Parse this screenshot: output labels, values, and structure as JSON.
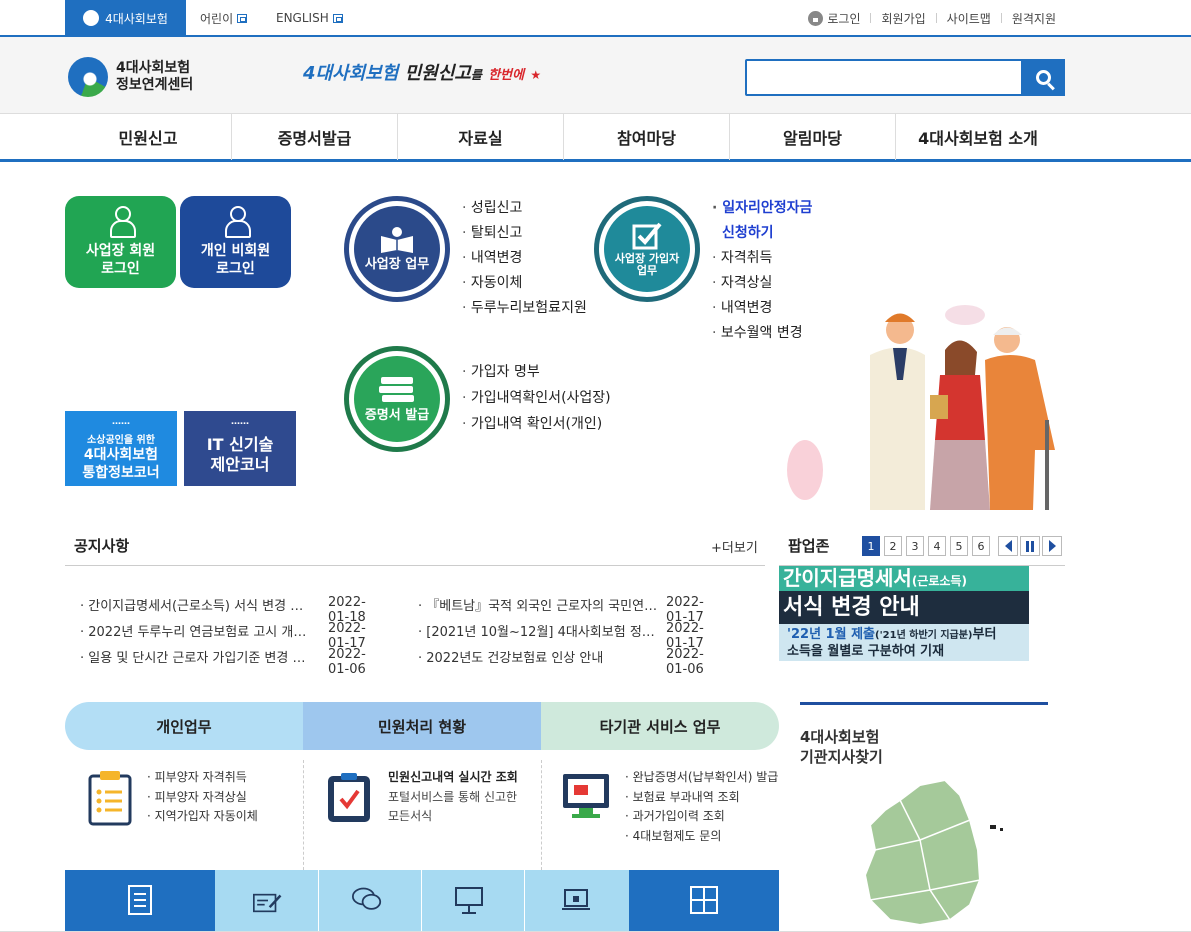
{
  "utility": {
    "main_tab": "4대사회보험",
    "kids": "어린이",
    "english": "ENGLISH",
    "login": "로그인",
    "join": "회원가입",
    "sitemap": "사이트맵",
    "remote": "원격지원"
  },
  "header": {
    "logo_line1": "4대사회보험",
    "logo_line2": "정보연계센터",
    "slogan_a": "4대사회보험",
    "slogan_b": "민원신고",
    "slogan_c": "를",
    "slogan_d": "한번에",
    "search_placeholder": ""
  },
  "gnb": [
    "민원신고",
    "증명서발급",
    "자료실",
    "참여마당",
    "알림마당",
    "4대사회보험 소개"
  ],
  "login_tiles": {
    "business_line1": "사업장 회원",
    "business_line2": "로그인",
    "personal_line1": "개인 비회원",
    "personal_line2": "로그인"
  },
  "promos": {
    "smallbiz_small": "소상공인을 위한",
    "smallbiz_line1": "4대사회보험",
    "smallbiz_line2": "통합정보코너",
    "it_line1": "IT 신기술",
    "it_line2": "제안코너"
  },
  "work": {
    "business": {
      "label": "사업장 업무",
      "items": [
        "성립신고",
        "탈퇴신고",
        "내역변경",
        "자동이체",
        "두루누리보험료지원"
      ]
    },
    "subscriber": {
      "label_line1": "사업장 가입자",
      "label_line2": "업무",
      "highlight_line1": "일자리안정자금",
      "highlight_line2": "신청하기",
      "items": [
        "자격취득",
        "자격상실",
        "내역변경",
        "보수월액 변경"
      ]
    },
    "certificate": {
      "label": "증명서 발급",
      "items": [
        "가입자 명부",
        "가입내역확인서(사업장)",
        "가입내역 확인서(개인)"
      ]
    }
  },
  "notice": {
    "title": "공지사항",
    "more": "+더보기",
    "items": [
      {
        "title": "간이지급명세서(근로소득) 서식 변경 …",
        "date": "2022-01-18"
      },
      {
        "title": "2022년 두루누리 연금보험료 고시 개…",
        "date": "2022-01-17"
      },
      {
        "title": "일용 및 단시간 근로자 가입기준 변경 …",
        "date": "2022-01-06"
      },
      {
        "title": "『베트남』국적 외국인 근로자의 국민연…",
        "date": "2022-01-17"
      },
      {
        "title": "[2021년 10월~12월] 4대사회보험 정…",
        "date": "2022-01-17"
      },
      {
        "title": "2022년도 건강보험료 인상 안내",
        "date": "2022-01-06"
      }
    ]
  },
  "popup": {
    "title": "팝업존",
    "pages": [
      "1",
      "2",
      "3",
      "4",
      "5",
      "6"
    ],
    "banner_line1": "간이지급명세서",
    "banner_line1_tag": "(근로소득)",
    "banner_line2": "서식 변경 안내",
    "banner_line3a": "'22년 1월 제출",
    "banner_line3b": "('21년 하반기 지급분)",
    "banner_line3c": "부터",
    "banner_line4": "소득을 월별로 구분하여 기재"
  },
  "services": {
    "tabs": [
      "개인업무",
      "민원처리 현황",
      "타기관 서비스 업무"
    ],
    "personal": [
      "피부양자 자격취득",
      "피부양자 자격상실",
      "지역가입자 자동이체"
    ],
    "status_title": "민원신고내역 실시간 조회",
    "status_desc1": "포털서비스를 통해 신고한",
    "status_desc2": "모든서식",
    "other": [
      "완납증명서(납부확인서) 발급",
      "보험료 부과내역 조회",
      "과거가입이력 조회",
      "4대보험제도 문의"
    ]
  },
  "branch": {
    "title_line1": "4대사회보험",
    "title_line2": "기관지사찾기"
  },
  "colors": {
    "primary": "#1f6fc0",
    "navy": "#2b4a8a",
    "green": "#21a553"
  }
}
